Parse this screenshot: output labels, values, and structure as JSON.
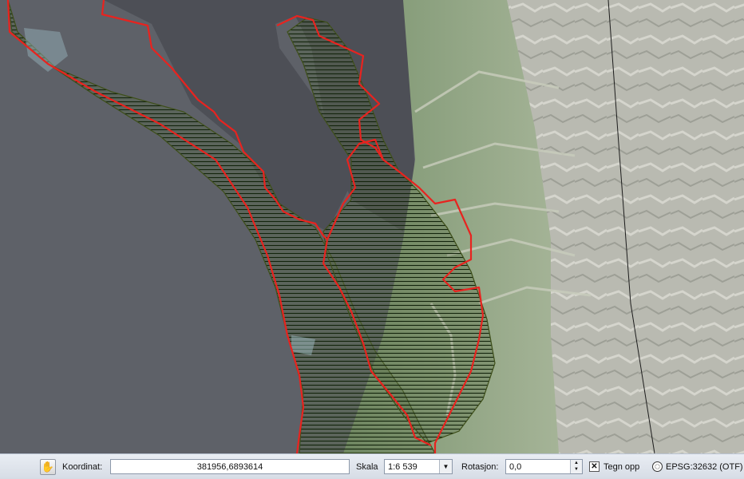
{
  "statusbar": {
    "coordinate_label": "Koordinat:",
    "coordinate_value": "381956,6893614",
    "scale_label": "Skala",
    "scale_value": "1:6 539",
    "rotation_label": "Rotasjon:",
    "rotation_value": "0,0",
    "render_label": "Tegn opp",
    "render_checked": true,
    "crs_label": "EPSG:32632 (OTF)"
  },
  "map": {
    "layers": [
      {
        "name": "aerial-imagery",
        "type": "raster"
      },
      {
        "name": "hatched-zone-polygon",
        "type": "polygon",
        "fill": "#4f6a3e",
        "hatch": "#1f3a14",
        "outline": "#4c5a1c"
      },
      {
        "name": "red-boundary",
        "type": "polygon",
        "outline": "#e8231f"
      }
    ]
  },
  "icons": {
    "messages": "messages-icon",
    "dropdown": "chevron-down-icon",
    "spin_up": "spin-up-icon",
    "spin_down": "spin-down-icon",
    "crs": "globe-icon"
  }
}
